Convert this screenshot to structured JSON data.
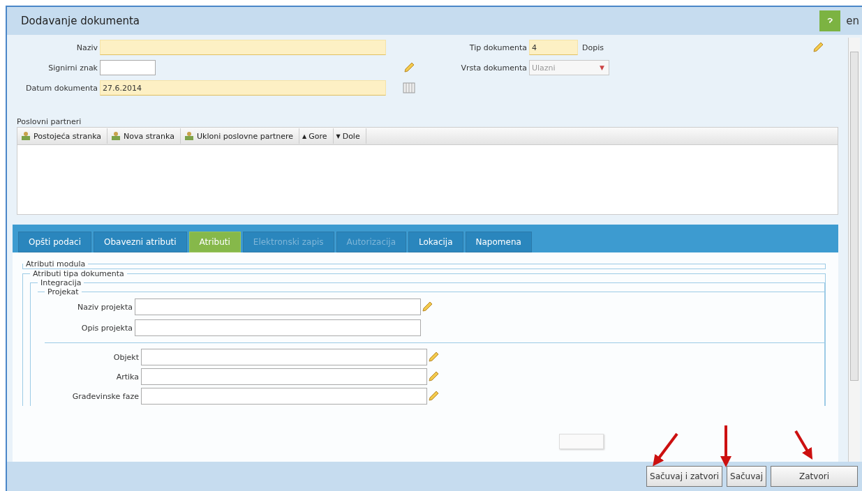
{
  "window": {
    "title": "Dodavanje dokumenta",
    "language": "en"
  },
  "form": {
    "left": [
      {
        "label": "Naziv",
        "kind": "required"
      },
      {
        "label": "Signirni znak",
        "kind": "short"
      },
      {
        "label": "Datum dokumenta",
        "value": "27.6.2014",
        "kind": "date"
      }
    ],
    "document_type": {
      "label": "Tip dokumenta",
      "value": "4",
      "name": "Dopis"
    },
    "document_kind": {
      "label": "Vrsta dokumenta",
      "value": "Ulazni",
      "caret": "▼",
      "disabled": true
    }
  },
  "partners": {
    "label": "Poslovni partneri",
    "toolbar": [
      {
        "label": "Postojeća stranka",
        "kind": "party"
      },
      {
        "label": "Nova stranka",
        "kind": "party"
      },
      {
        "label": "Ukloni poslovne partnere",
        "kind": "party"
      },
      {
        "label": "Gore",
        "kind": "move",
        "symbol": "▲"
      },
      {
        "label": "Dole",
        "kind": "move",
        "symbol": "▼"
      }
    ]
  },
  "tabs": [
    {
      "label": "Opšti podaci",
      "selected": false,
      "disabled": false
    },
    {
      "label": "Obavezni atributi",
      "selected": false,
      "disabled": false
    },
    {
      "label": "Atributi",
      "selected": true,
      "disabled": false
    },
    {
      "label": "Elektronski zapis",
      "selected": false,
      "disabled": true
    },
    {
      "label": "Autorizacija",
      "selected": false,
      "disabled": true
    },
    {
      "label": "Lokacija",
      "selected": false,
      "disabled": false
    },
    {
      "label": "Napomena",
      "selected": false,
      "disabled": false
    }
  ],
  "attributes": {
    "module_section": "Atributi modula",
    "type_section": "Atributi tipa dokumenta",
    "integration": "Integracija",
    "project": "Projekat",
    "project_fields": [
      {
        "label": "Naziv projekta",
        "pencil": true
      },
      {
        "label": "Opis projekta",
        "pencil": false
      }
    ],
    "other_fields": [
      {
        "label": "Objekt",
        "pencil": true
      },
      {
        "label": "Artika",
        "pencil": true
      },
      {
        "label": "Građevinske faze",
        "pencil": true
      }
    ]
  },
  "buttons": [
    {
      "label": "Sačuvaj i zatvori",
      "wide": false
    },
    {
      "label": "Sačuvaj",
      "wide": false
    },
    {
      "label": "Zatvori",
      "wide": true
    }
  ]
}
